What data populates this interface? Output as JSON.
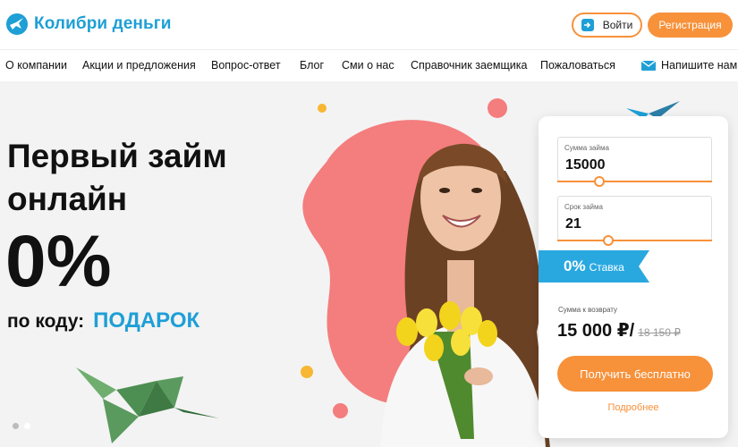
{
  "header": {
    "logo_text": "Колибри деньги",
    "login_label": "Войти",
    "register_label": "Регистрация"
  },
  "nav": {
    "items": [
      "О компании",
      "Акции и предложения",
      "Вопрос-ответ",
      "Блог",
      "Сми о нас",
      "Справочник заемщика",
      "Пожаловаться"
    ],
    "contact_label": "Напишите нам"
  },
  "hero": {
    "title_line1": "Первый займ",
    "title_line2": "онлайн",
    "percent": "0%",
    "code_prefix": "по коду:",
    "code": "ПОДАРОК"
  },
  "calculator": {
    "amount_label": "Сумма займа",
    "amount_value": "15000",
    "amount_slider_fraction": 0.27,
    "term_label": "Срок займа",
    "term_value": "21",
    "term_slider_fraction": 0.33,
    "rate_value": "0%",
    "rate_label": "Ставка",
    "return_label": "Сумма к возврату",
    "return_value": "15 000 ₽/",
    "return_old": "18 150 ₽",
    "submit_label": "Получить бесплатно",
    "more_label": "Подробнее"
  },
  "colors": {
    "brand_blue": "#1e9fd6",
    "brand_orange": "#f7913a",
    "blob_pink": "#f47d7d",
    "ribbon_blue": "#29a8e0",
    "bird_green": "#5a9a5e"
  }
}
